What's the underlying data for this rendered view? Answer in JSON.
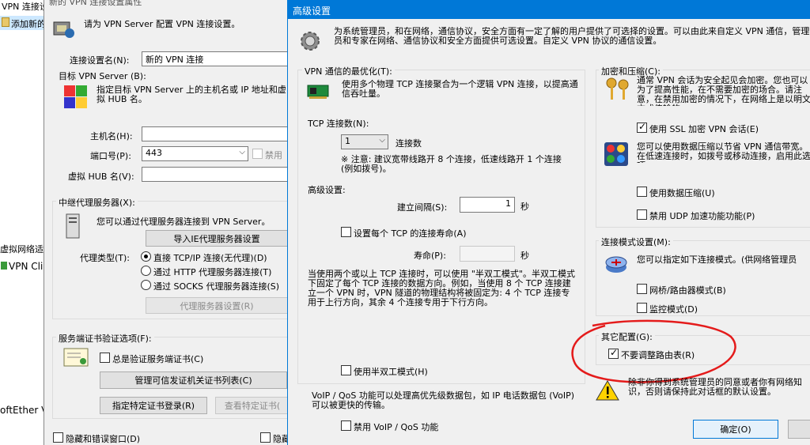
{
  "background_window": {
    "title": "VPN 连接设...",
    "menu_item": "添加新的",
    "tree_header": "虚拟网络适",
    "tree_item": "VPN Cli",
    "footer_text": "oftEther V"
  },
  "connection_dialog": {
    "title": "新的 VPN 连接设置属性",
    "intro": "请为 VPN Server 配置 VPN 连接设置。",
    "setting_name_label": "连接设置名(N):",
    "setting_name_value": "新的 VPN 连接",
    "target_group": "目标 VPN Server (B):",
    "target_desc": "指定目标 VPN Server 上的主机名或 IP 地址和虚拟 HUB 名。",
    "host_label": "主机名(H):",
    "host_value": "",
    "port_label": "端口号(P):",
    "port_value": "443",
    "disable_label": "禁用",
    "hub_label": "虚拟 HUB 名(V):",
    "hub_value": "",
    "proxy_group": "中继代理服务器(X):",
    "proxy_desc": "您可以通过代理服务器连接到 VPN Server。",
    "import_ie_button": "导入IE代理服务器设置",
    "proxy_type_label": "代理类型(T):",
    "proxy_direct": "直接 TCP/IP 连接(无代理)(D)",
    "proxy_http": "通过 HTTP 代理服务器连接(T)",
    "proxy_socks": "通过 SOCKS 代理服务器连接(S)",
    "proxy_settings_button": "代理服务器设置(R)",
    "cert_group": "服务端证书验证选项(F):",
    "always_verify": "总是验证服务端证书(C)",
    "manage_ca_button": "管理可信发证机关证书列表(C)",
    "specify_cert_button": "指定特定证书登录(R)",
    "view_cert_button": "查看特定证书(",
    "hide_error_window": "隐藏和错误窗口(D)",
    "hide_other": "隐藏"
  },
  "advanced_dialog": {
    "title": "高级设置",
    "header_text": "为系统管理员，和在网络，通信协议，安全方面有一定了解的用户提供了可选择的设置。可以由此来自定义 VPN 通信，管理员和专家在网络、通信协议和安全方面提供可选设置。自定义 VPN 协议的通信设置。",
    "opt_group": "VPN 通信的最优化(T):",
    "opt_desc": "使用多个物理 TCP 连接聚合为一个逻辑 VPN 连接，以提高通信吞吐量。",
    "tcp_count_label": "TCP 连接数(N):",
    "tcp_count_value": "1",
    "tcp_count_unit": "连接数",
    "tcp_note": "※ 注意: 建议宽带线路开 8 个连接，低速线路开 1 个连接 (例如拨号)。",
    "advanced_label": "高级设置:",
    "interval_label": "建立间隔(S):",
    "interval_value": "1",
    "interval_unit": "秒",
    "lifetime_check": "设置每个 TCP 的连接寿命(A)",
    "lifetime_label": "寿命(P):",
    "lifetime_value": "",
    "lifetime_unit": "秒",
    "half_duplex_desc": "当使用两个或以上 TCP 连接时，可以使用 \"半双工模式\"。半双工模式下固定了每个 TCP 连接的数据方向。例如，当使用 8 个 TCP 连接建立一个 VPN 时，VPN 隧道的物理结构将被固定为: 4 个 TCP 连接专用于上行方向，其余 4 个连接专用于下行方向。",
    "half_duplex_check": "使用半双工模式(H)",
    "qos_desc": "VoIP / QoS 功能可以处理高优先级数据包，如 IP 电话数据包 (VoIP) 可以被更快的传输。",
    "qos_check": "禁用 VoIP / QoS 功能",
    "enc_group": "加密和压缩(C):",
    "enc_desc": "通常 VPN 会话为安全起见会加密。您也可以为了提高性能，在不需要加密的场合。请注意，在禁用加密的情况下，在网络上是以明文方式传输的。",
    "ssl_check": "使用 SSL 加密 VPN 会话(E)",
    "compress_desc": "您可以使用数据压缩以节省 VPN 通信带宽。在低速连接时，如拨号或移动连接，启用此选项。",
    "compress_check": "使用数据压缩(U)",
    "udp_check": "禁用 UDP 加速功能功能(P)",
    "mode_group": "连接模式设置(M):",
    "mode_desc": "您可以指定如下连接模式。(供网络管理员",
    "bridge_check": "网桥/路由器模式(B)",
    "monitor_check": "监控模式(D)",
    "other_group": "其它配置(G):",
    "no_route_check": "不要调整路由表(R)",
    "warning_text": "除非你得到系统管理员的同意或者你有网络知识，否则请保持此对话框的默认设置。",
    "ok_button": "确定(O)"
  },
  "colors": {
    "dialog_bg": "#f0f0f0",
    "titlebar_active": "#0078d7",
    "annotation_red": "#e41b1b"
  }
}
